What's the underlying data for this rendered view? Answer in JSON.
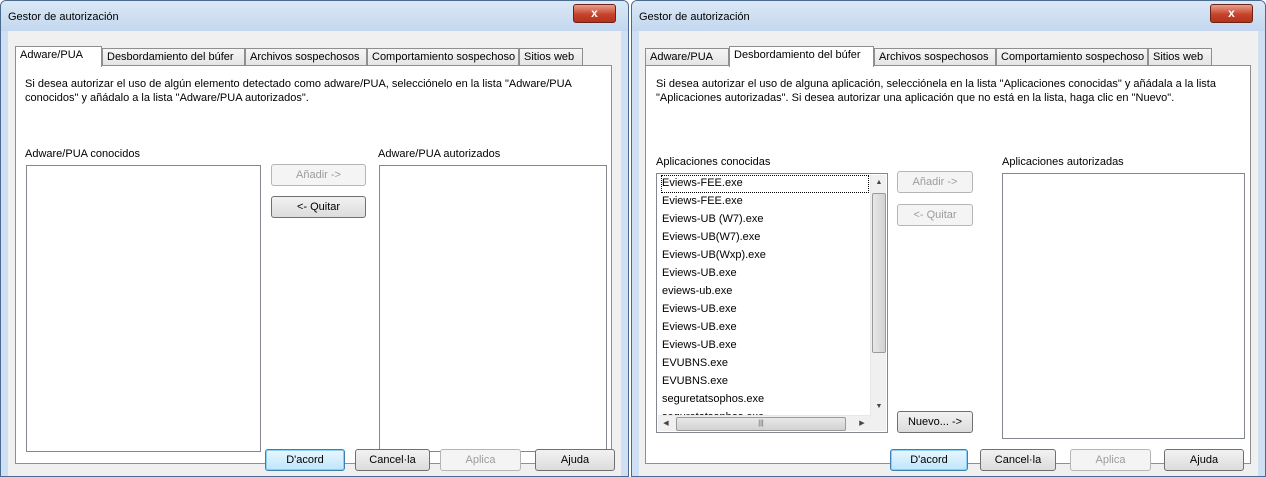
{
  "left": {
    "title": "Gestor de autorización",
    "close_label": "x",
    "tabs": [
      "Adware/PUA",
      "Desbordamiento del búfer",
      "Archivos sospechosos",
      "Comportamiento sospechoso",
      "Sitios web"
    ],
    "active_tab": "Adware/PUA",
    "description": "Si desea autorizar el uso de algún elemento detectado como adware/PUA, selecciónelo en la lista \"Adware/PUA conocidos\" y añádalo a la lista \"Adware/PUA autorizados\".",
    "known_label": "Adware/PUA conocidos",
    "authorized_label": "Adware/PUA autorizados",
    "add_button": "Añadir ->",
    "remove_button": "<- Quitar",
    "ok_button": "D'acord",
    "cancel_button": "Cancel·la",
    "apply_button": "Aplica",
    "help_button": "Ajuda"
  },
  "right": {
    "title": "Gestor de autorización",
    "close_label": "x",
    "tabs": [
      "Adware/PUA",
      "Desbordamiento del búfer",
      "Archivos sospechosos",
      "Comportamiento sospechoso",
      "Sitios web"
    ],
    "active_tab": "Desbordamiento del búfer",
    "description": "Si desea autorizar el uso de alguna aplicación, selecciónela en la lista \"Aplicaciones conocidas\" y añádala a la lista \"Aplicaciones autorizadas\". Si desea autorizar una aplicación que no está en la lista, haga clic en \"Nuevo\".",
    "known_label": "Aplicaciones conocidas",
    "authorized_label": "Aplicaciones autorizadas",
    "known_items": [
      "Eviews-FEE.exe",
      "Eviews-FEE.exe",
      "Eviews-UB (W7).exe",
      "Eviews-UB(W7).exe",
      "Eviews-UB(Wxp).exe",
      "Eviews-UB.exe",
      "eviews-ub.exe",
      "Eviews-UB.exe",
      "Eviews-UB.exe",
      "Eviews-UB.exe",
      "EVUBNS.exe",
      "EVUBNS.exe",
      "seguretatsophos.exe",
      "seguretatsophos.exe"
    ],
    "add_button": "Añadir ->",
    "remove_button": "<- Quitar",
    "new_button": "Nuevo... ->",
    "ok_button": "D'acord",
    "cancel_button": "Cancel·la",
    "apply_button": "Aplica",
    "help_button": "Ajuda"
  }
}
